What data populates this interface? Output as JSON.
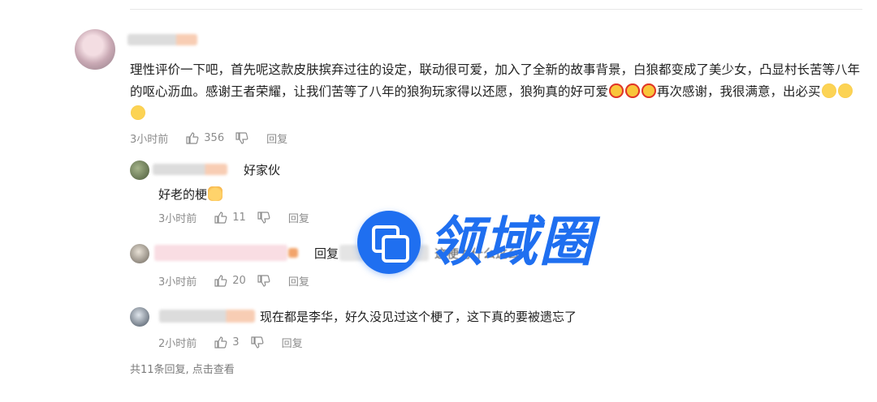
{
  "main_comment": {
    "text_part1": "理性评价一下吧，首先呢这款皮肤摈弃过往的设定，联动很可爱，加入了全新的故事背景，白狼都变成了美少女，凸显村长苦等八年的呕心沥血。感谢王者荣耀，让我们苦等了八年的狼狗玩家得以还愿，狼狗真的好可爱",
    "text_part2": "再次感谢，我很满意，出必买",
    "time": "3小时前",
    "likes": "356",
    "reply_label": "回复"
  },
  "replies": [
    {
      "text": "好家伙",
      "body": "好老的梗",
      "time": "3小时前",
      "likes": "11",
      "reply_label": "回复"
    },
    {
      "prefix": "回复",
      "body": "这梗为什么这么",
      "time": "3小时前",
      "likes": "20",
      "reply_label": "回复"
    },
    {
      "text": "现在都是李华，好久没见过这个梗了，这下真的要被遗忘了",
      "time": "2小时前",
      "likes": "3",
      "reply_label": "回复"
    }
  ],
  "footer": {
    "text": "共11条回复, 点击查看"
  },
  "watermark": {
    "text": "领域圈"
  },
  "colors": {
    "accent": "#1f6ff0",
    "meta": "#8c8c8c"
  }
}
